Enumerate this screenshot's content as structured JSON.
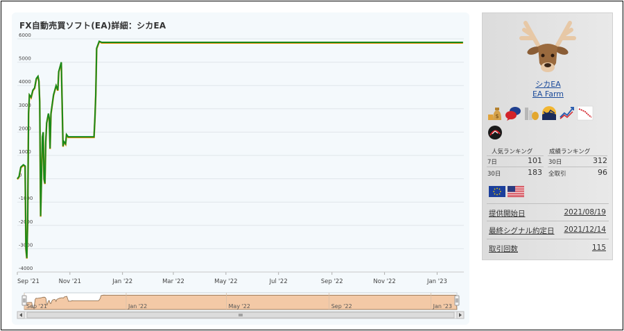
{
  "chart": {
    "title": "FX自動売買ソフト(EA)詳細：シカEA"
  },
  "chart_data": {
    "type": "line",
    "title": "FX自動売買ソフト(EA)詳細：シカEA",
    "yticks": [
      "6000",
      "5000",
      "4000",
      "3000",
      "2000",
      "1000",
      "0",
      "-1000",
      "-2000",
      "-3000",
      "-4000"
    ],
    "ylim": [
      -4000,
      6000
    ],
    "xticks": [
      "Sep '21",
      "Nov '21",
      "Jan '22",
      "Mar '22",
      "May '22",
      "Jul '22",
      "Sep '22",
      "Nov '22",
      "Jan '23"
    ],
    "navigator_ticks": [
      "Sep '21",
      "Jan '22",
      "May '22",
      "Sep '22",
      "Jan '23"
    ],
    "grid": true,
    "series": [
      {
        "color": "#178a1c",
        "points": [
          [
            "2021-09-01",
            0
          ],
          [
            "2021-09-03",
            100
          ],
          [
            "2021-09-05",
            500
          ],
          [
            "2021-09-08",
            600
          ],
          [
            "2021-09-10",
            550
          ],
          [
            "2021-09-11",
            -3000
          ],
          [
            "2021-09-12",
            -3400
          ],
          [
            "2021-09-13",
            -1800
          ],
          [
            "2021-09-14",
            2800
          ],
          [
            "2021-09-15",
            3600
          ],
          [
            "2021-09-17",
            3500
          ],
          [
            "2021-09-19",
            3800
          ],
          [
            "2021-09-21",
            3900
          ],
          [
            "2021-09-23",
            4300
          ],
          [
            "2021-09-25",
            4400
          ],
          [
            "2021-09-26",
            4200
          ],
          [
            "2021-09-27",
            3300
          ],
          [
            "2021-09-28",
            -1600
          ],
          [
            "2021-09-29",
            0
          ],
          [
            "2021-09-30",
            1800
          ],
          [
            "2021-10-01",
            2000
          ],
          [
            "2021-10-02",
            0
          ],
          [
            "2021-10-03",
            -200
          ],
          [
            "2021-10-04",
            1600
          ],
          [
            "2021-10-05",
            2400
          ],
          [
            "2021-10-07",
            2800
          ],
          [
            "2021-10-08",
            2600
          ],
          [
            "2021-10-09",
            1300
          ],
          [
            "2021-10-10",
            2800
          ],
          [
            "2021-10-13",
            3600
          ],
          [
            "2021-10-16",
            4000
          ],
          [
            "2021-10-18",
            3800
          ],
          [
            "2021-10-19",
            4600
          ],
          [
            "2021-10-22",
            5000
          ],
          [
            "2021-10-24",
            1400
          ],
          [
            "2021-10-25",
            1600
          ],
          [
            "2021-10-27",
            1500
          ],
          [
            "2021-10-28",
            1900
          ],
          [
            "2021-10-30",
            1800
          ],
          [
            "2021-11-15",
            1800
          ],
          [
            "2021-11-29",
            1800
          ],
          [
            "2021-11-30",
            2600
          ],
          [
            "2021-12-01",
            3600
          ],
          [
            "2021-12-02",
            5600
          ],
          [
            "2021-12-05",
            5900
          ],
          [
            "2021-12-08",
            5850
          ],
          [
            "2023-01-31",
            5850
          ]
        ]
      }
    ]
  },
  "sidebar": {
    "avatar_icon": "deer-icon",
    "ea_name": "シカEA",
    "vendor": "EA Farm",
    "badges": [
      "money-bag-icon",
      "speech-bubbles-icon",
      "coin-stack-icon",
      "sunrise-chart-icon",
      "uptrend-icon",
      "downtrend-icon",
      "bull-bear-icon"
    ],
    "popularity_rank_title": "人気ランキング",
    "performance_rank_title": "成績ランキング",
    "popularity_rows": [
      {
        "label": "7日",
        "value": "101"
      },
      {
        "label": "30日",
        "value": "183"
      }
    ],
    "performance_rows": [
      {
        "label": "30日",
        "value": "312"
      },
      {
        "label": "全取引",
        "value": "96"
      }
    ],
    "currency_flags": [
      "eu-flag-icon",
      "us-flag-icon"
    ],
    "info_rows": [
      {
        "label": "提供開始日",
        "value": "2021/08/19"
      },
      {
        "label": "最終シグナル約定日",
        "value": "2021/12/14"
      },
      {
        "label": "取引回数",
        "value": "115"
      }
    ]
  },
  "colors": {
    "line": "#178a1c",
    "line_shadow": "#e08a00",
    "navigator_fill": "#f3c9a6",
    "panel_bg": "#f4f9fc",
    "link": "#1a4a9a"
  }
}
